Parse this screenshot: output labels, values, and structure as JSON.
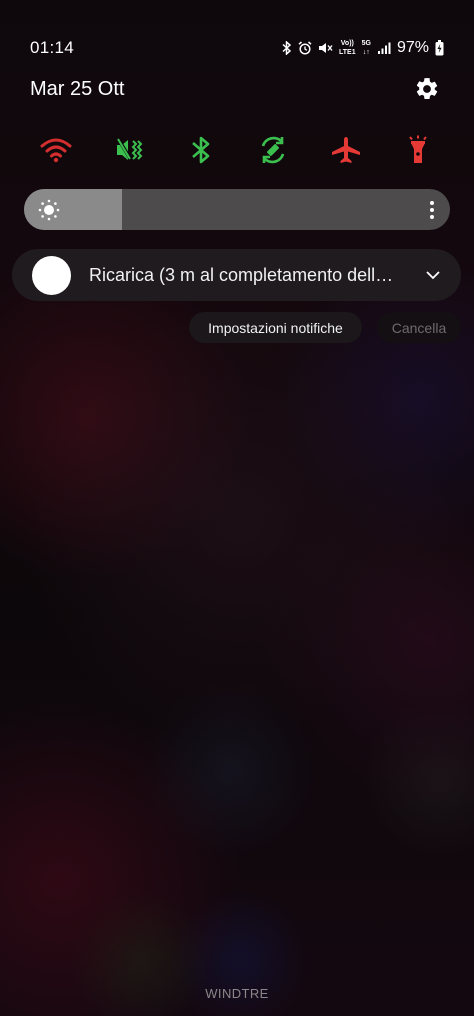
{
  "status_bar": {
    "time": "01:14",
    "volte_top": "Vo))",
    "volte_bottom": "LTE1",
    "network_top": "5G",
    "network_bottom": "↓↑",
    "battery_percent": "97%",
    "icons": [
      "bluetooth-icon",
      "alarm-icon",
      "mute-icon",
      "volte-icon",
      "5g-icon",
      "signal-icon",
      "battery-charging-icon"
    ]
  },
  "header": {
    "date": "Mar 25 Ott",
    "settings_icon": "gear-icon"
  },
  "quick_settings": {
    "tiles": [
      {
        "icon": "wifi-icon",
        "color": "#d32f2f",
        "state": "off"
      },
      {
        "icon": "vibrate-icon",
        "color": "#3bbf4f",
        "state": "on"
      },
      {
        "icon": "bluetooth-icon",
        "color": "#3bbf4f",
        "state": "on"
      },
      {
        "icon": "auto-rotate-icon",
        "color": "#3bbf4f",
        "state": "on"
      },
      {
        "icon": "airplane-icon",
        "color": "#e53935",
        "state": "off"
      },
      {
        "icon": "flashlight-icon",
        "color": "#e53935",
        "state": "off"
      }
    ]
  },
  "brightness": {
    "level": 0.23,
    "icon": "sun-icon"
  },
  "notification": {
    "title": "Ricarica (3 m al completamento dell…",
    "expand_icon": "chevron-down-icon"
  },
  "actions": {
    "settings_label": "Impostazioni notifiche",
    "clear_label": "Cancella"
  },
  "footer": {
    "carrier": "WINDTRE"
  }
}
